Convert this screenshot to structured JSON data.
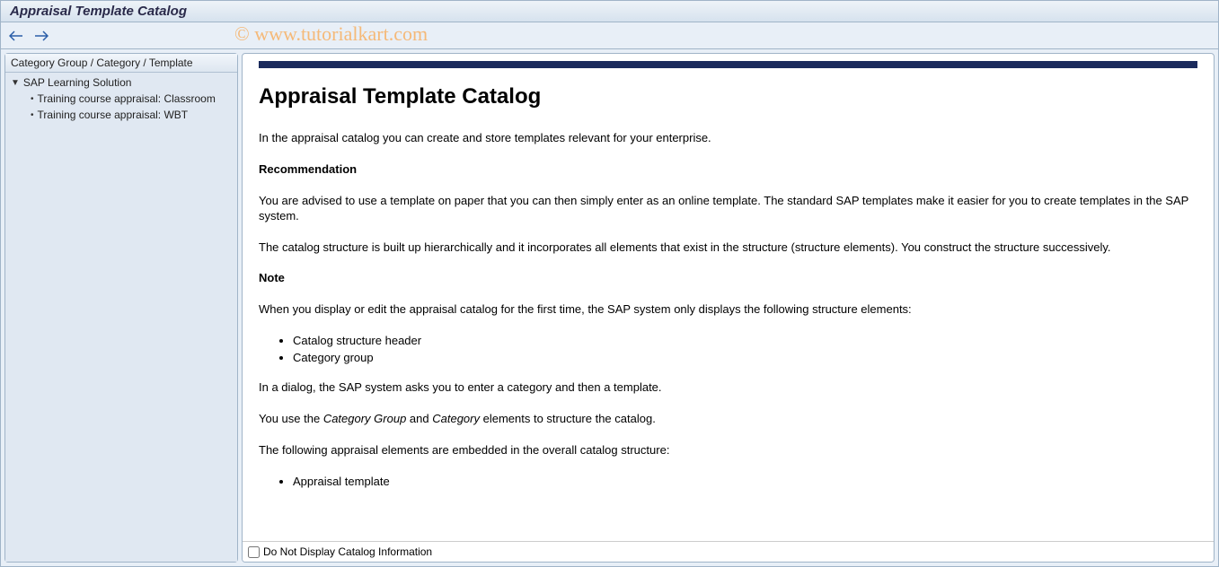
{
  "window": {
    "title": "Appraisal Template Catalog"
  },
  "watermark": "© www.tutorialkart.com",
  "sidebar": {
    "header": "Category Group / Category / Template",
    "root": "SAP Learning Solution",
    "items": [
      "Training course appraisal: Classroom",
      "Training course appraisal: WBT"
    ]
  },
  "content": {
    "heading": "Appraisal Template Catalog",
    "intro": "In the appraisal catalog you can create and store templates relevant for your enterprise.",
    "recommendation_label": "Recommendation",
    "recommendation_text": "You are advised to use a template on paper that you can then simply enter as an online template. The standard SAP templates make it easier for you to create templates in the SAP system.",
    "structure_text": "The catalog structure is built up hierarchically and it incorporates all elements that exist in the structure (structure elements). You construct the structure successively.",
    "note_label": "Note",
    "note_text": "When you display or edit the appraisal catalog for the first time, the SAP system only displays the following structure elements:",
    "note_list": [
      "Catalog structure header",
      "Category group"
    ],
    "dialog_text": "In a dialog, the SAP system asks you to enter a category and then a template.",
    "usage_prefix": "You use the ",
    "usage_em1": "Category Group",
    "usage_mid": " and ",
    "usage_em2": "Category",
    "usage_suffix": " elements to structure the catalog.",
    "embedded_text": "The following appraisal elements are embedded in the overall catalog structure:",
    "embedded_list": [
      "Appraisal template"
    ]
  },
  "footer": {
    "checkbox_label": "Do Not Display Catalog Information"
  }
}
